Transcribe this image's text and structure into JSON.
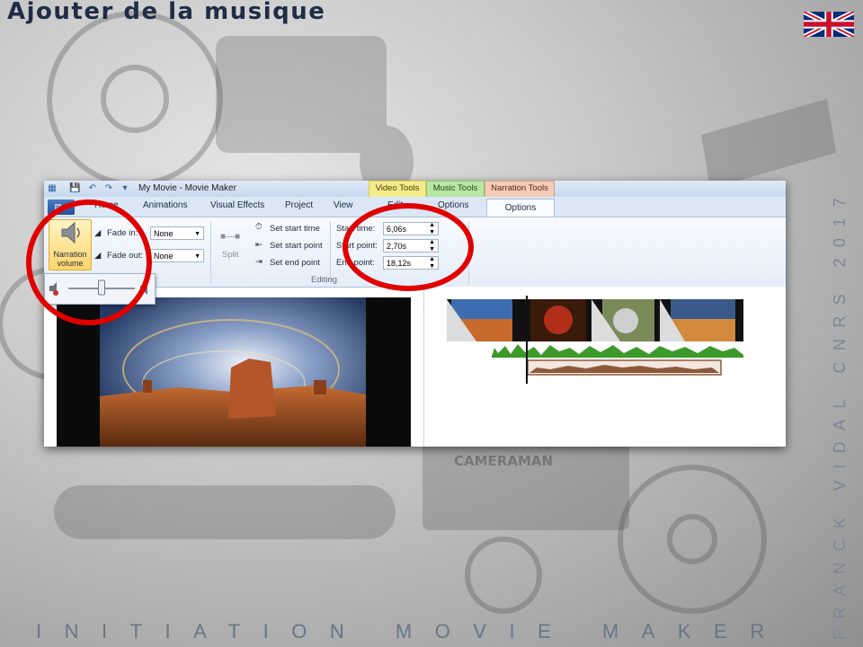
{
  "slide": {
    "title": "Ajouter de la musique",
    "side_text": "FRANCK VIDAL CNRS 2017",
    "bottom_text": "INITIATION MOVIE MAKER",
    "flag_icon": "uk-flag-icon",
    "background_watermark": "CAMERAMAN"
  },
  "window": {
    "title": "My Movie - Movie Maker",
    "context_tabs": [
      "Video Tools",
      "Music Tools",
      "Narration Tools"
    ]
  },
  "tabs": [
    "Home",
    "Animations",
    "Visual Effects",
    "Project",
    "View",
    "Edit",
    "Options",
    "Options"
  ],
  "active_tab": "Options",
  "ribbon": {
    "narration_volume_label": "Narration volume",
    "fade_in_label": "Fade in:",
    "fade_in_value": "None",
    "fade_out_label": "Fade out:",
    "fade_out_value": "None",
    "split_label": "Split",
    "set_start_time": "Set start time",
    "set_start_point": "Set start point",
    "set_end_point": "Set end point",
    "start_time_label": "Start time:",
    "start_time_value": "6,06s",
    "start_point_label": "Start point:",
    "start_point_value": "2,70s",
    "end_point_label": "End point:",
    "end_point_value": "18,12s",
    "editing_group_label": "Editing"
  },
  "volume_slider_level": 0.5,
  "colors": {
    "title": "#1f2d47",
    "highlight_ring": "#e00000",
    "music_track": "#3c9a2b",
    "narration_track": "#8b5a3c"
  }
}
